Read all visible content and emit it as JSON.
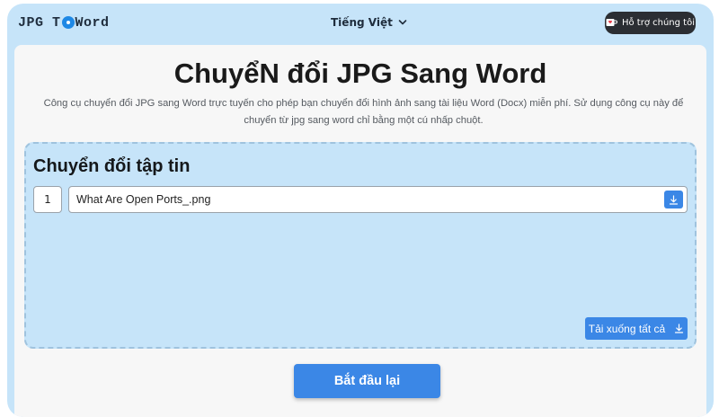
{
  "header": {
    "logo_left": "JPG T",
    "logo_right": " Word",
    "language": "Tiếng Việt",
    "support_label": "Hỗ trợ chúng tôi"
  },
  "main": {
    "title": "ChuyểN đổi JPG Sang Word",
    "description": "Công cụ chuyển đổi JPG sang Word trực tuyến cho phép bạn chuyển đổi hình ảnh sang tài liệu Word (Docx) miễn phí. Sử dụng công cụ này để chuyển từ jpg sang word chỉ bằng một cú nhấp chuột."
  },
  "converter": {
    "title": "Chuyển đổi tập tin",
    "files": [
      {
        "index": "1",
        "name": "What Are Open Ports_.png"
      }
    ],
    "download_all_label": "Tải xuống tất cả",
    "restart_label": "Bắt đầu lại"
  },
  "icons": {
    "language_toggle": "chevron-down-icon",
    "support": "coffee-cup-icon",
    "download": "download-icon"
  },
  "colors": {
    "accent": "#3b87e6",
    "background": "#c6e4f9",
    "dark_button": "#2b2e33"
  }
}
